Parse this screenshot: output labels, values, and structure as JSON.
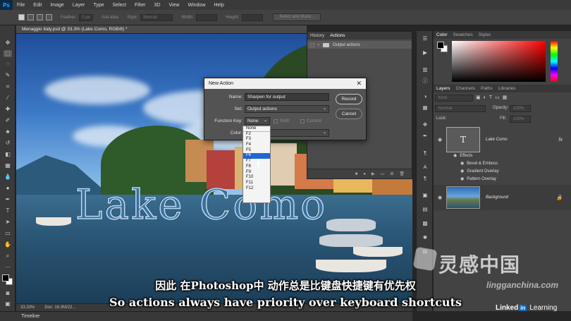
{
  "app": {
    "logo": "Ps"
  },
  "menu": [
    "File",
    "Edit",
    "Image",
    "Layer",
    "Type",
    "Select",
    "Filter",
    "3D",
    "View",
    "Window",
    "Help"
  ],
  "options_bar": {
    "feather_label": "Feather:",
    "feather_value": "0 px",
    "antialias_label": "Anti-alias",
    "style_label": "Style:",
    "style_value": "Normal",
    "width_label": "Width:",
    "height_label": "Height:",
    "select_mask": "Select and Mask..."
  },
  "document": {
    "tab_title": "Menaggio Italy.psd @ 33.3% (Lake Como, RGB/8) *",
    "canvas_text": "Lake Como",
    "zoom": "33.33%",
    "doc_info": "Doc: 16.0M/22..."
  },
  "timeline": {
    "label": "Timeline"
  },
  "actions_panel": {
    "tabs": [
      "History",
      "Actions"
    ],
    "active_tab": "Actions",
    "items": [
      {
        "label": "Output actions"
      }
    ]
  },
  "dialog": {
    "title": "New Action",
    "name_label": "Name:",
    "name_value": "Sharpen for output",
    "set_label": "Set:",
    "set_value": "Output actions",
    "fkey_label": "Function Key:",
    "fkey_value": "None",
    "shift_label": "Shift",
    "control_label": "Control",
    "color_label": "Color:",
    "record_button": "Record",
    "cancel_button": "Cancel"
  },
  "fkey_list": {
    "options": [
      "None",
      "F2",
      "F3",
      "F4",
      "F5",
      "F6",
      "F7",
      "F8",
      "F9",
      "F10",
      "F11",
      "F12"
    ],
    "selected": "F6"
  },
  "color_panel": {
    "tabs": [
      "Color",
      "Swatches",
      "Styles"
    ],
    "active_tab": "Color"
  },
  "layers_panel": {
    "tabs": [
      "Layers",
      "Channels",
      "Paths",
      "Libraries"
    ],
    "active_tab": "Layers",
    "kind_placeholder": "Kind",
    "blend_mode": "Normal",
    "opacity_label": "Opacity:",
    "opacity_value": "100%",
    "lock_label": "Lock:",
    "fill_label": "Fill:",
    "fill_value": "100%",
    "layers": [
      {
        "name": "Lake Como",
        "fx": "fx",
        "effects_label": "Effects",
        "effects": [
          "Bevel & Emboss",
          "Gradient Overlay",
          "Pattern Overlay"
        ]
      },
      {
        "name": "Background"
      }
    ]
  },
  "subtitles": {
    "chinese": "因此 在Photoshop中 动作总是比键盘快捷键有优先权",
    "english": "So actions always have priority over keyboard shortcuts"
  },
  "watermark": {
    "cn": "灵感中国",
    "url": "lingganchina.com"
  },
  "brand": {
    "linked": "Linked",
    "in": "in",
    "learning": "Learning"
  },
  "colors": {
    "accent_blue": "#1e66d6",
    "ps_blue": "#31a8ff",
    "linkedin_blue": "#0a66c2"
  }
}
